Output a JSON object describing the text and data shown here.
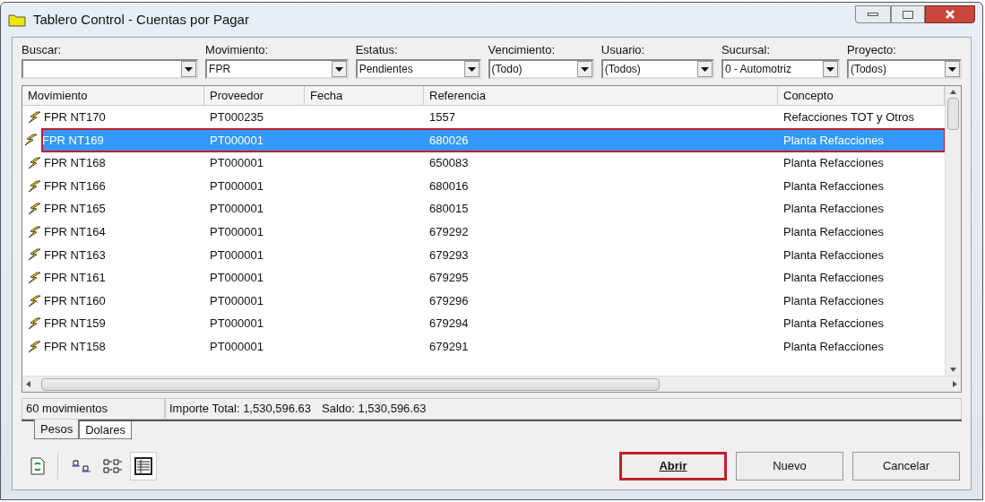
{
  "window": {
    "title": "Tablero Control - Cuentas por Pagar"
  },
  "filters": [
    {
      "label": "Buscar:"
    },
    {
      "label": "Movimiento:",
      "value": "FPR"
    },
    {
      "label": "Estatus:",
      "value": "Pendientes"
    },
    {
      "label": "Vencimiento:",
      "value": "(Todo)"
    },
    {
      "label": "Usuario:",
      "value": "(Todos)"
    },
    {
      "label": "Sucursal:",
      "value": "0 - Automotriz"
    },
    {
      "label": "Proyecto:",
      "value": "(Todos)"
    }
  ],
  "table": {
    "columns": [
      "Movimiento",
      "Proveedor",
      "Fecha",
      "Referencia",
      "Concepto"
    ],
    "rows": [
      {
        "movimiento": "FPR NT170",
        "proveedor": "PT000235",
        "referencia": "1557",
        "concepto": "Refacciones TOT y Otros",
        "selected": false
      },
      {
        "movimiento": "FPR NT169",
        "proveedor": "PT000001",
        "referencia": "680026",
        "concepto": "Planta Refacciones",
        "selected": true
      },
      {
        "movimiento": "FPR NT168",
        "proveedor": "PT000001",
        "referencia": "650083",
        "concepto": "Planta Refacciones",
        "selected": false
      },
      {
        "movimiento": "FPR NT166",
        "proveedor": "PT000001",
        "referencia": "680016",
        "concepto": "Planta Refacciones",
        "selected": false
      },
      {
        "movimiento": "FPR NT165",
        "proveedor": "PT000001",
        "referencia": "680015",
        "concepto": "Planta Refacciones",
        "selected": false
      },
      {
        "movimiento": "FPR NT164",
        "proveedor": "PT000001",
        "referencia": "679292",
        "concepto": "Planta Refacciones",
        "selected": false
      },
      {
        "movimiento": "FPR NT163",
        "proveedor": "PT000001",
        "referencia": "679293",
        "concepto": "Planta Refacciones",
        "selected": false
      },
      {
        "movimiento": "FPR NT161",
        "proveedor": "PT000001",
        "referencia": "679295",
        "concepto": "Planta Refacciones",
        "selected": false
      },
      {
        "movimiento": "FPR NT160",
        "proveedor": "PT000001",
        "referencia": "679296",
        "concepto": "Planta Refacciones",
        "selected": false
      },
      {
        "movimiento": "FPR NT159",
        "proveedor": "PT000001",
        "referencia": "679294",
        "concepto": "Planta Refacciones",
        "selected": false
      },
      {
        "movimiento": "FPR NT158",
        "proveedor": "PT000001",
        "referencia": "679291",
        "concepto": "Planta Refacciones",
        "selected": false
      }
    ]
  },
  "status_bar": {
    "count": "60 movimientos",
    "importe": "Importe Total: 1,530,596.63",
    "saldo": "Saldo: 1,530,596.63"
  },
  "tabs": [
    {
      "label": "Pesos",
      "selected": true
    },
    {
      "label": "Dolares",
      "selected": false
    }
  ],
  "buttons": [
    {
      "label": "Abrir",
      "default": true
    },
    {
      "label": "Nuevo",
      "default": false
    },
    {
      "label": "Cancelar",
      "default": false
    }
  ]
}
